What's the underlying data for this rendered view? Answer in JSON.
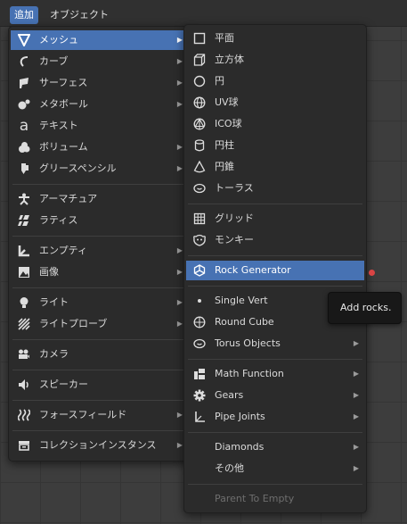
{
  "topbar": {
    "add": "追加",
    "object": "オブジェクト"
  },
  "main_menu": {
    "items": [
      {
        "label": "メッシュ",
        "icon": "mesh-icon"
      },
      {
        "label": "カーブ",
        "icon": "curve-icon"
      },
      {
        "label": "サーフェス",
        "icon": "surface-icon"
      },
      {
        "label": "メタボール",
        "icon": "metaball-icon"
      },
      {
        "label": "テキスト",
        "icon": "text-icon"
      },
      {
        "label": "ボリューム",
        "icon": "volume-icon"
      },
      {
        "label": "グリースペンシル",
        "icon": "grease-pencil-icon"
      },
      {
        "label": "アーマチュア",
        "icon": "armature-icon"
      },
      {
        "label": "ラティス",
        "icon": "lattice-icon"
      },
      {
        "label": "エンプティ",
        "icon": "empty-icon"
      },
      {
        "label": "画像",
        "icon": "image-icon"
      },
      {
        "label": "ライト",
        "icon": "light-icon"
      },
      {
        "label": "ライトプローブ",
        "icon": "light-probe-icon"
      },
      {
        "label": "カメラ",
        "icon": "camera-icon"
      },
      {
        "label": "スピーカー",
        "icon": "speaker-icon"
      },
      {
        "label": "フォースフィールド",
        "icon": "force-field-icon"
      },
      {
        "label": "コレクションインスタンス",
        "icon": "collection-instance-icon"
      }
    ]
  },
  "mesh_menu": {
    "items": [
      {
        "label": "平面",
        "icon": "plane-icon"
      },
      {
        "label": "立方体",
        "icon": "cube-icon"
      },
      {
        "label": "円",
        "icon": "circle-icon"
      },
      {
        "label": "UV球",
        "icon": "uv-sphere-icon"
      },
      {
        "label": "ICO球",
        "icon": "ico-sphere-icon"
      },
      {
        "label": "円柱",
        "icon": "cylinder-icon"
      },
      {
        "label": "円錐",
        "icon": "cone-icon"
      },
      {
        "label": "トーラス",
        "icon": "torus-icon"
      },
      {
        "label": "グリッド",
        "icon": "grid-icon"
      },
      {
        "label": "モンキー",
        "icon": "monkey-icon"
      },
      {
        "label": "Rock Generator",
        "icon": "rock-icon"
      },
      {
        "label": "Single Vert",
        "icon": "vertex-icon"
      },
      {
        "label": "Round Cube",
        "icon": "round-cube-icon"
      },
      {
        "label": "Torus Objects",
        "icon": "torus-objects-icon"
      },
      {
        "label": "Math Function",
        "icon": "math-function-icon"
      },
      {
        "label": "Gears",
        "icon": "gear-icon"
      },
      {
        "label": "Pipe Joints",
        "icon": "pipe-joint-icon"
      },
      {
        "label": "Diamonds",
        "icon": ""
      },
      {
        "label": "その他",
        "icon": ""
      },
      {
        "label": "Parent To Empty",
        "icon": ""
      }
    ]
  },
  "tooltip": {
    "text": "Add rocks."
  },
  "colors": {
    "highlight": "#4772b3",
    "menu_bg": "#2b2b2b",
    "tooltip_bg": "#181818",
    "red_dot": "#d94444"
  }
}
